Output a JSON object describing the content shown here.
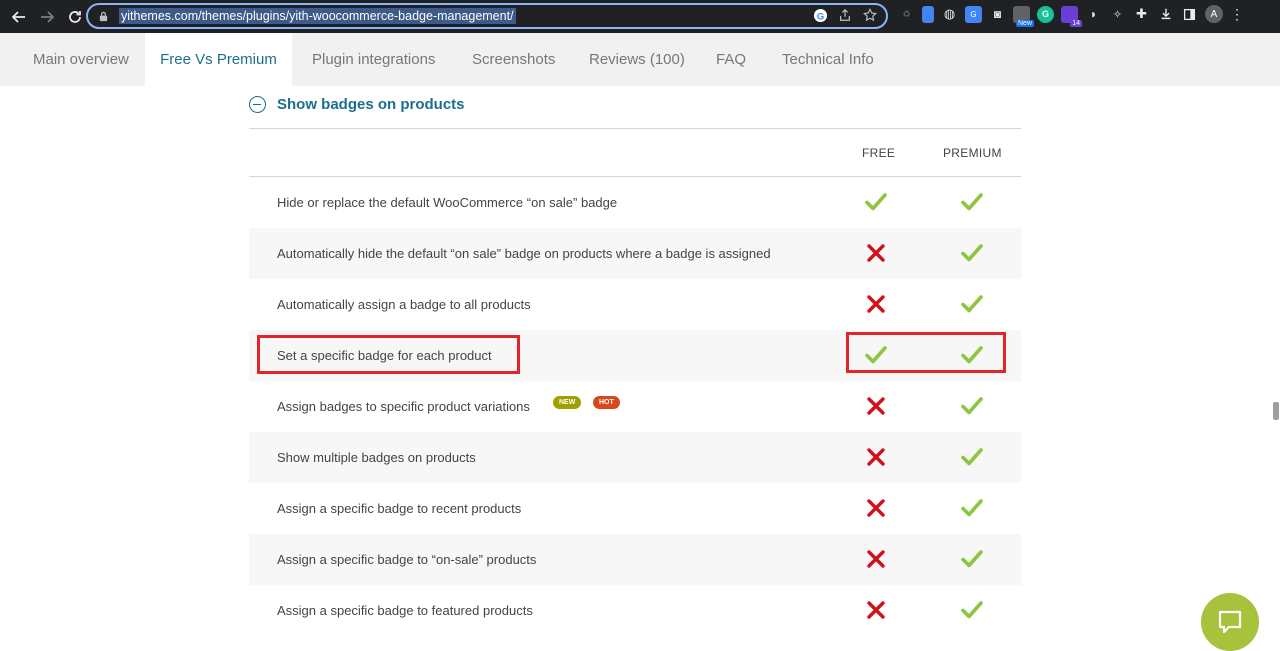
{
  "browser": {
    "url": "yithemes.com/themes/plugins/yith-woocommerce-badge-management/",
    "profile_initial": "A",
    "extension_badges": {
      "new": "New",
      "count": "14"
    }
  },
  "tabs": [
    {
      "label": "Main overview"
    },
    {
      "label": "Free Vs Premium"
    },
    {
      "label": "Plugin integrations"
    },
    {
      "label": "Screenshots"
    },
    {
      "label": "Reviews (100)"
    },
    {
      "label": "FAQ"
    },
    {
      "label": "Technical Info"
    }
  ],
  "active_tab": "Free Vs Premium",
  "section": {
    "title": "Show badges on products"
  },
  "table": {
    "col_free": "FREE",
    "col_premium": "PREMIUM",
    "rows": [
      {
        "feature": "Hide or replace the default WooCommerce “on sale” badge",
        "free": "check",
        "premium": "check"
      },
      {
        "feature": "Automatically hide the default “on sale” badge on products where a badge is assigned",
        "free": "cross",
        "premium": "check"
      },
      {
        "feature": "Automatically assign a badge to all products",
        "free": "cross",
        "premium": "check"
      },
      {
        "feature": "Set a specific badge for each product",
        "free": "check",
        "premium": "check"
      },
      {
        "feature": "Assign badges to specific product variations",
        "free": "cross",
        "premium": "check",
        "pills": [
          "NEW",
          "HOT"
        ]
      },
      {
        "feature": "Show multiple badges on products",
        "free": "cross",
        "premium": "check"
      },
      {
        "feature": "Assign a specific badge to recent products",
        "free": "cross",
        "premium": "check"
      },
      {
        "feature": "Assign a specific badge to “on-sale” products",
        "free": "cross",
        "premium": "check"
      },
      {
        "feature": "Assign a specific badge to featured products",
        "free": "cross",
        "premium": "check"
      }
    ]
  },
  "colors": {
    "accent": "#1c6f8c",
    "check": "#8cc63f",
    "cross": "#d0101a",
    "highlight": "#e3242b",
    "pill_new": "#a0a000",
    "pill_hot": "#d9481c",
    "chat": "#a6c33b"
  },
  "icons": {
    "check": "check-icon",
    "cross": "cross-icon",
    "chat": "chat-bubble-icon",
    "toggle": "minus-circle-icon"
  }
}
